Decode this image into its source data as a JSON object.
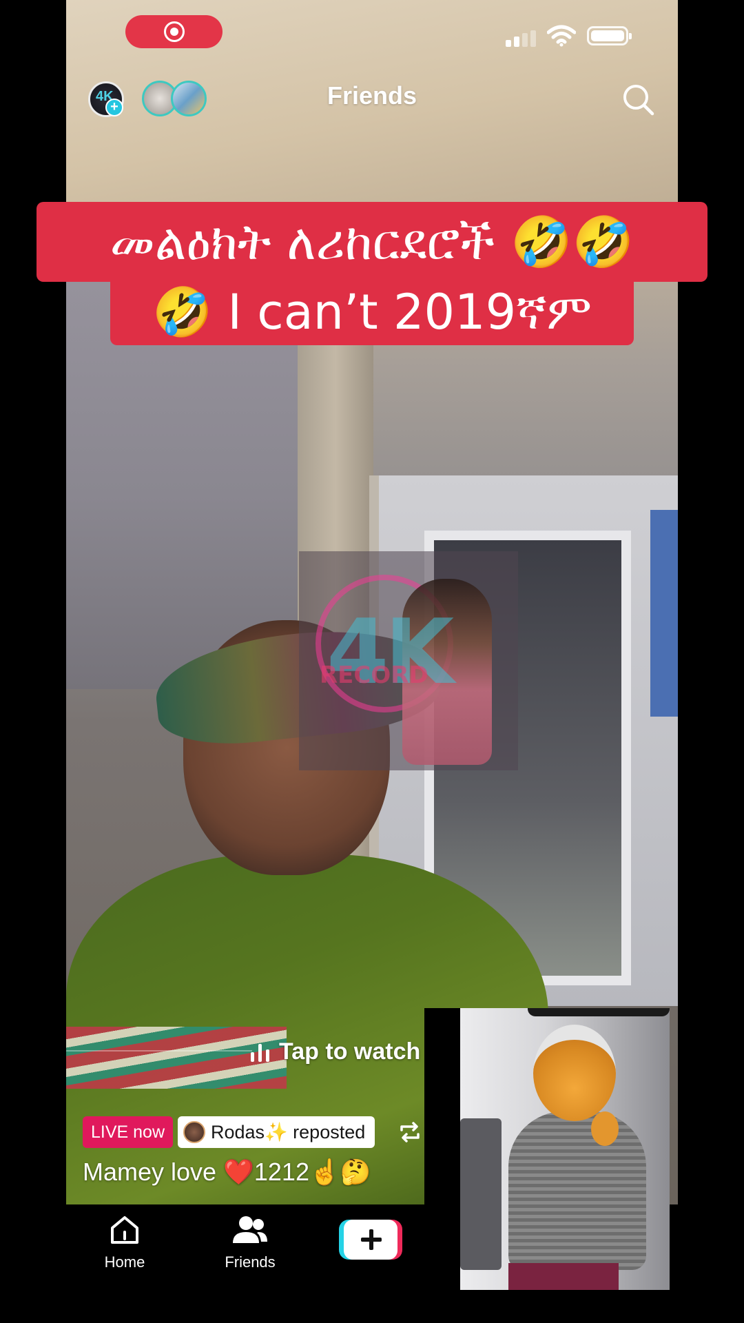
{
  "status_bar": {
    "recording_indicator": "screen-record-icon",
    "signal": "cellular-signal-icon",
    "wifi": "wifi-icon",
    "battery": "battery-icon"
  },
  "top_nav": {
    "title": "Friends",
    "profile_avatar_text": "4K",
    "add_story_icon": "plus-icon",
    "search_icon": "search-icon"
  },
  "caption": {
    "line1": "መልዕክት ለሪከርደሮች 🤣🤣",
    "line2": "🤣 I can’t  2019ኛም"
  },
  "watermark": {
    "big_text": "4K",
    "sub_text": "RECORD"
  },
  "video_overlay": {
    "tap_to_watch": "Tap to watch"
  },
  "post": {
    "live_badge": "LIVE now",
    "reposted_by": "Rodas✨ reposted",
    "description": "Mamey love ❤️1212☝️🤔"
  },
  "bottom_nav": {
    "items": [
      {
        "label": "Home",
        "icon": "home-icon"
      },
      {
        "label": "Friends",
        "icon": "friends-icon"
      }
    ],
    "create_icon": "plus-icon"
  },
  "colors": {
    "caption_red": "#df2f45",
    "live_pink": "#e0195c",
    "record_red": "#e33548",
    "create_cyan": "#25d2e6",
    "create_pink": "#ef2a5a"
  }
}
